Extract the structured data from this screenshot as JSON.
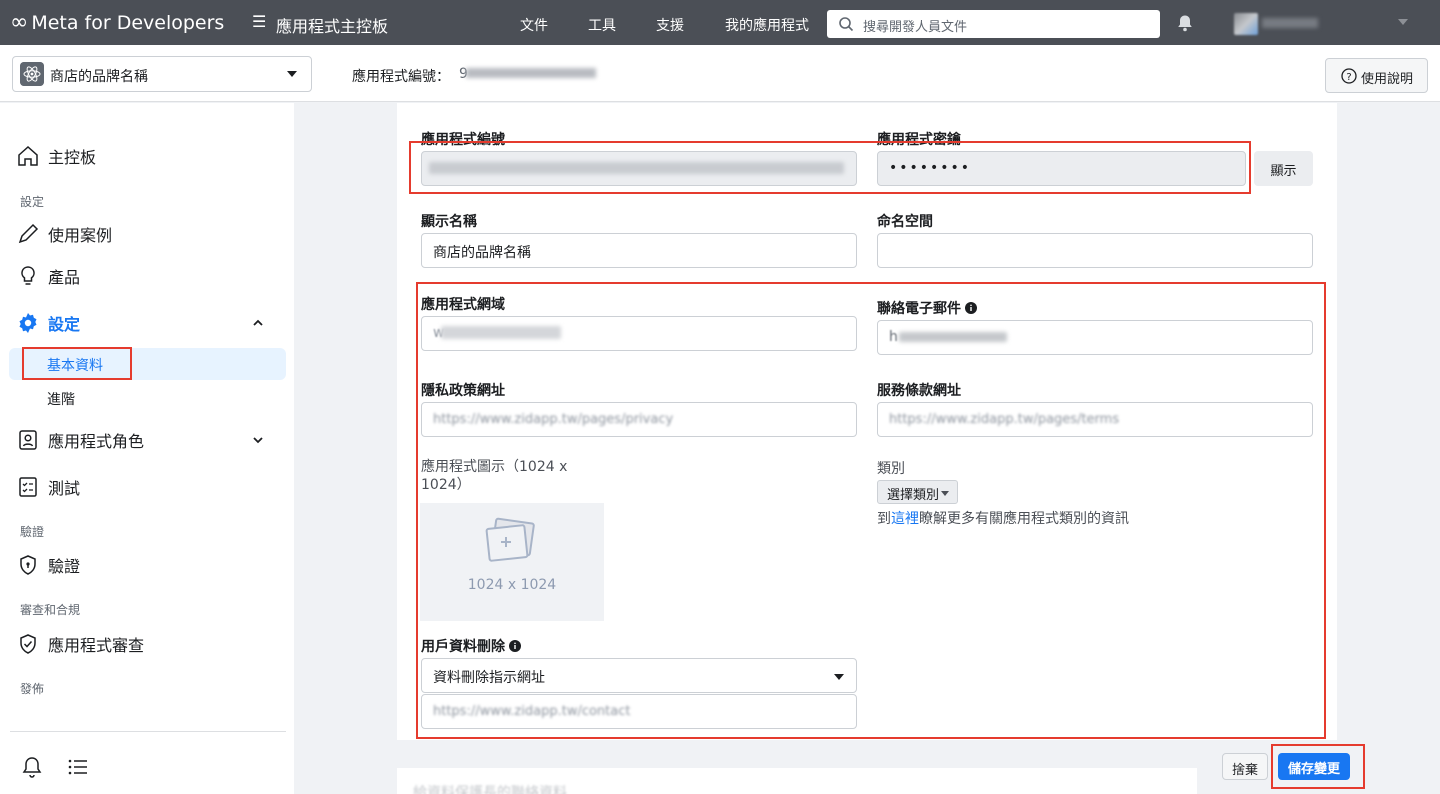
{
  "topbar": {
    "brand": "Meta for Developers",
    "app_dashboard": "應用程式主控板",
    "nav": [
      "文件",
      "工具",
      "支援",
      "我的應用程式"
    ],
    "search_placeholder": "搜尋開發人員文件"
  },
  "subbar": {
    "app_name": "商店的品牌名稱",
    "app_id_label": "應用程式編號：",
    "app_id_prefix": "9",
    "help_label": "使用說明"
  },
  "sidebar": {
    "dashboard": "主控板",
    "section_settings": "設定",
    "use_cases": "使用案例",
    "products": "產品",
    "settings": "設定",
    "basic": "基本資料",
    "advanced": "進階",
    "app_roles": "應用程式角色",
    "testing": "測試",
    "section_verification": "驗證",
    "verification": "驗證",
    "section_review": "審查和合規",
    "app_review": "應用程式審查",
    "section_publish": "發佈"
  },
  "form": {
    "app_id_label": "應用程式編號",
    "app_secret_label": "應用程式密鑰",
    "app_secret_value": "••••••••",
    "show_button": "顯示",
    "display_name_label": "顯示名稱",
    "display_name_value": "商店的品牌名稱",
    "namespace_label": "命名空間",
    "app_domains_label": "應用程式網域",
    "app_domains_value": "w",
    "contact_email_label": "聯絡電子郵件",
    "contact_email_value": "h",
    "privacy_label": "隱私政策網址",
    "privacy_value": "https://www.zidapp.tw/pages/privacy",
    "terms_label": "服務條款網址",
    "terms_value": "https://www.zidapp.tw/pages/terms",
    "icon_label": "應用程式圖示（1024 x 1024）",
    "icon_dim": "1024 x 1024",
    "category_label": "類別",
    "category_button": "選擇類別",
    "category_help_prefix": "到",
    "category_help_link": "這裡",
    "category_help_suffix": "瞭解更多有關應用程式類別的資訊",
    "data_deletion_label": "用戶資料刪除",
    "data_deletion_select": "資料刪除指示網址",
    "data_deletion_value": "https://www.zidapp.tw/contact"
  },
  "footer": {
    "discard": "捨棄",
    "save": "儲存變更",
    "next_section": "給資料保護長的聯絡資料"
  },
  "colors": {
    "accent": "#1877f2",
    "highlight": "#e53b2e",
    "topbar": "#4b4f56"
  }
}
